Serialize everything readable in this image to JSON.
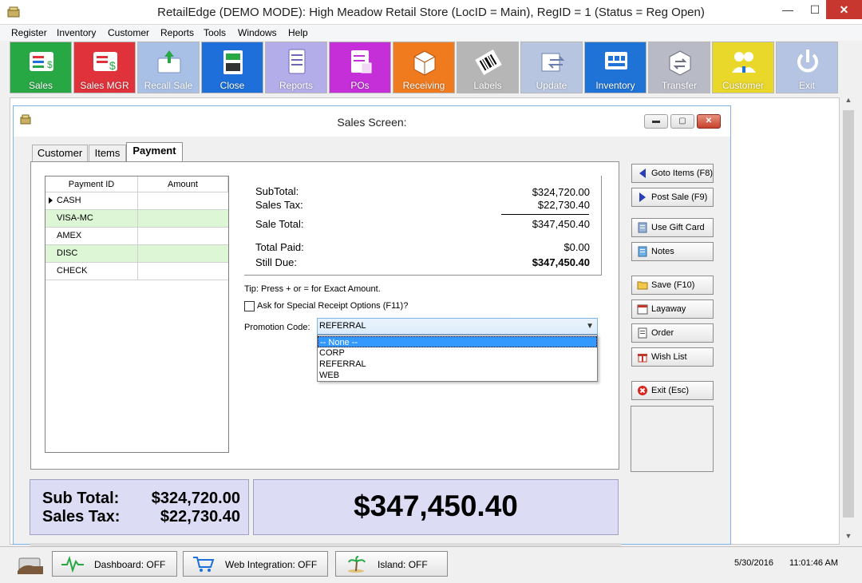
{
  "window": {
    "title": "RetailEdge (DEMO MODE): High Meadow Retail Store (LocID = Main),  RegID = 1 (Status = Reg Open)",
    "minimize": "—",
    "maximize": "☐",
    "close": "✕"
  },
  "menu": [
    "Register",
    "Inventory",
    "Customer",
    "Reports",
    "Tools",
    "Windows",
    "Help"
  ],
  "toolbar": [
    {
      "label": "Sales",
      "color": "#28a745",
      "icon": "sales-icon"
    },
    {
      "label": "Sales MGR",
      "color": "#e0323b",
      "icon": "sales-manager-icon"
    },
    {
      "label": "Recall Sale",
      "color": "#a9c0e6",
      "icon": "recall-sale-icon"
    },
    {
      "label": "Close",
      "color": "#1e6fd9",
      "icon": "close-register-icon"
    },
    {
      "label": "Reports",
      "color": "#b3aee9",
      "icon": "reports-icon"
    },
    {
      "label": "POs",
      "color": "#c42fd8",
      "icon": "purchase-orders-icon"
    },
    {
      "label": "Receiving",
      "color": "#f07b1f",
      "icon": "receiving-box-icon"
    },
    {
      "label": "Labels",
      "color": "#b6b6b6",
      "icon": "barcode-label-icon"
    },
    {
      "label": "Update",
      "color": "#b7c5e0",
      "icon": "update-icon"
    },
    {
      "label": "Inventory",
      "color": "#1f73d6",
      "icon": "inventory-icon"
    },
    {
      "label": "Transfer",
      "color": "#b8bac6",
      "icon": "transfer-icon"
    },
    {
      "label": "Customer",
      "color": "#e9d72a",
      "icon": "customer-icon"
    },
    {
      "label": "Exit",
      "color": "#b6c4e4",
      "icon": "power-icon"
    }
  ],
  "sales_window": {
    "title": "Sales Screen:",
    "tabs": [
      "Customer",
      "Items",
      "Payment"
    ],
    "active_tab": "Payment"
  },
  "payment_grid": {
    "headers": [
      "Payment ID",
      "Amount"
    ],
    "rows": [
      {
        "id": "CASH",
        "amount": "",
        "highlight": false
      },
      {
        "id": "VISA-MC",
        "amount": "",
        "highlight": true
      },
      {
        "id": "AMEX",
        "amount": "",
        "highlight": false
      },
      {
        "id": "DISC",
        "amount": "",
        "highlight": true
      },
      {
        "id": "CHECK",
        "amount": "",
        "highlight": false
      }
    ]
  },
  "totals": {
    "subtotal_label": "SubTotal:",
    "subtotal": "$324,720.00",
    "tax_label": "Sales Tax:",
    "tax": "$22,730.40",
    "sale_total_label": "Sale Total:",
    "sale_total": "$347,450.40",
    "total_paid_label": "Total Paid:",
    "total_paid": "$0.00",
    "still_due_label": "Still Due:",
    "still_due": "$347,450.40"
  },
  "tip": "Tip: Press + or = for Exact Amount.",
  "receipt_option": "Ask for Special Receipt Options (F11)?",
  "promotion": {
    "label": "Promotion Code:",
    "value": "REFERRAL",
    "options": [
      "-- None --",
      "CORP",
      "REFERRAL",
      "WEB"
    ],
    "highlighted": "-- None --"
  },
  "actions": {
    "goto_items": "Goto Items (F8)",
    "post_sale": "Post Sale (F9)",
    "gift_card": "Use Gift Card",
    "notes": "Notes",
    "save": "Save (F10)",
    "layaway": "Layaway",
    "order": "Order",
    "wish_list": "Wish List",
    "exit": "Exit (Esc)"
  },
  "summary": {
    "subtotal_label": "Sub Total:",
    "subtotal": "$324,720.00",
    "tax_label": "Sales Tax:",
    "tax": "$22,730.40",
    "grand_total": "$347,450.40"
  },
  "statusbar": {
    "dashboard": "Dashboard: OFF",
    "web": "Web Integration: OFF",
    "island": "Island: OFF",
    "date": "5/30/2016",
    "time": "11:01:46 AM"
  }
}
